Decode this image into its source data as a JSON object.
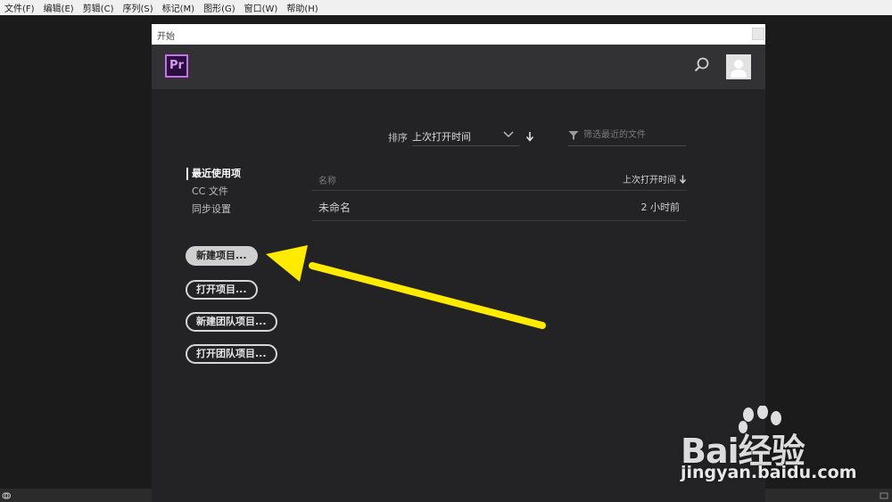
{
  "menubar": {
    "items": [
      "文件(F)",
      "编辑(E)",
      "剪辑(C)",
      "序列(S)",
      "标记(M)",
      "图形(G)",
      "窗口(W)",
      "帮助(H)"
    ]
  },
  "dialog": {
    "title": "开始",
    "app_logo": "Pr",
    "sort": {
      "label": "排序",
      "value": "上次打开时间"
    },
    "filter": {
      "placeholder": "筛选最近的文件"
    },
    "nav": [
      "最近使用项",
      "CC 文件",
      "同步设置"
    ],
    "table": {
      "col_name": "名称",
      "col_time": "上次打开时间",
      "rows": [
        {
          "name": "未命名",
          "time": "2 小时前"
        }
      ]
    },
    "buttons": {
      "new_project": "新建项目...",
      "open_project": "打开项目...",
      "new_team_project": "新建团队项目...",
      "open_team_project": "打开团队项目..."
    }
  },
  "watermark": {
    "logo": "Bai经验",
    "url": "jingyan.baidu.com"
  },
  "colors": {
    "accent": "#c86ef0",
    "annotation_arrow": "#ffeb00"
  },
  "icons": [
    "search-icon",
    "user-avatar-icon",
    "chevron-down-icon",
    "arrow-down-icon",
    "filter-icon",
    "close-icon",
    "creative-cloud-icon",
    "baidu-paw-icon"
  ]
}
